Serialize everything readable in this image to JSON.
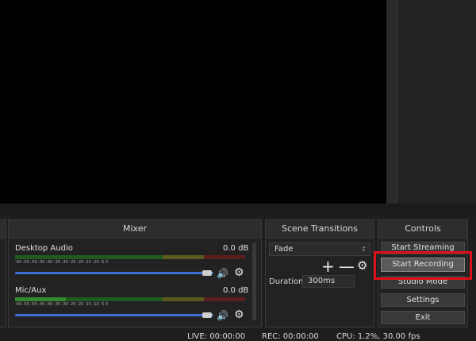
{
  "docks": {
    "mixer_title": "Mixer",
    "transitions_title": "Scene Transitions",
    "controls_title": "Controls"
  },
  "mixer": {
    "channels": [
      {
        "name": "Desktop Audio",
        "db": "0.0 dB"
      },
      {
        "name": "Mic/Aux",
        "db": "0.0 dB"
      }
    ],
    "tick_labels": "-60 -55 -50 -45 -40 -35 -30 -25 -20 -15 -10 -5 0"
  },
  "transitions": {
    "selected": "Fade",
    "duration_label": "Duration",
    "duration_value": "300ms"
  },
  "controls": {
    "start_streaming": "Start Streaming",
    "start_recording": "Start Recording",
    "studio_mode": "Studio Mode",
    "settings": "Settings",
    "exit": "Exit"
  },
  "status": {
    "live": "LIVE: 00:00:00",
    "rec": "REC: 00:00:00",
    "cpu": "CPU: 1.2%, 30.00 fps"
  },
  "colors": {
    "highlight": "#e0101a",
    "volume_slider": "#3d6fd6"
  }
}
